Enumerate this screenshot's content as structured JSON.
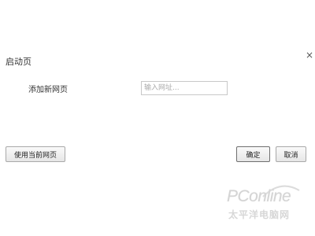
{
  "dialog": {
    "title": "启动页",
    "close_glyph": "×"
  },
  "new_page_row": {
    "label": "添加新网页",
    "url_placeholder": "输入网址..."
  },
  "buttons": {
    "use_current": "使用当前网页",
    "ok": "确定",
    "cancel": "取消"
  },
  "watermark": {
    "logo": "PConline",
    "subtitle": "太平洋电脑网"
  },
  "icons": {
    "close": "close-icon"
  }
}
